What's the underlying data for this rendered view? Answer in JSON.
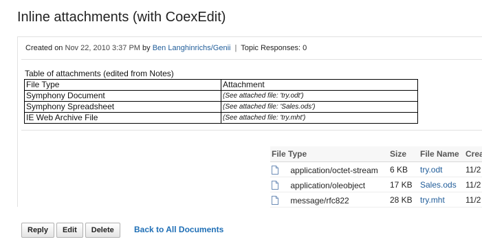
{
  "title": "Inline attachments (with CoexEdit)",
  "meta": {
    "created_label": "Created on",
    "created_date": "Nov 22, 2010 3:37 PM",
    "by_label": "by",
    "author": "Ben Langhinrichs/Genii",
    "separator": "|",
    "responses_label": "Topic Responses: 0"
  },
  "notes_table": {
    "caption": "Table of attachments (edited from Notes)",
    "headers": [
      "File Type",
      "Attachment"
    ],
    "rows": [
      {
        "type": "Symphony Document",
        "attachment": "(See attached file: 'try.odt')"
      },
      {
        "type": "Symphony Spreadsheet",
        "attachment": "(See attached file: 'Sales.ods')"
      },
      {
        "type": "IE Web Archive File",
        "attachment": "(See attached file: 'try.mht')"
      }
    ]
  },
  "files": {
    "headers": [
      "File Type",
      "Size",
      "File Name",
      "Crea"
    ],
    "rows": [
      {
        "icon": "document-icon",
        "type": "application/octet-stream",
        "size": "6 KB",
        "name": "try.odt",
        "created": "11/2"
      },
      {
        "icon": "document-icon",
        "type": "application/oleobject",
        "size": "17 KB",
        "name": "Sales.ods",
        "created": "11/2"
      },
      {
        "icon": "document-icon",
        "type": "message/rfc822",
        "size": "28 KB",
        "name": "try.mht",
        "created": "11/2"
      }
    ]
  },
  "actions": {
    "reply": "Reply",
    "edit": "Edit",
    "delete": "Delete",
    "back": "Back to All Documents"
  },
  "colors": {
    "link": "#1f5c99",
    "back_link": "#1f6fb6",
    "border": "#e1e1e1"
  }
}
